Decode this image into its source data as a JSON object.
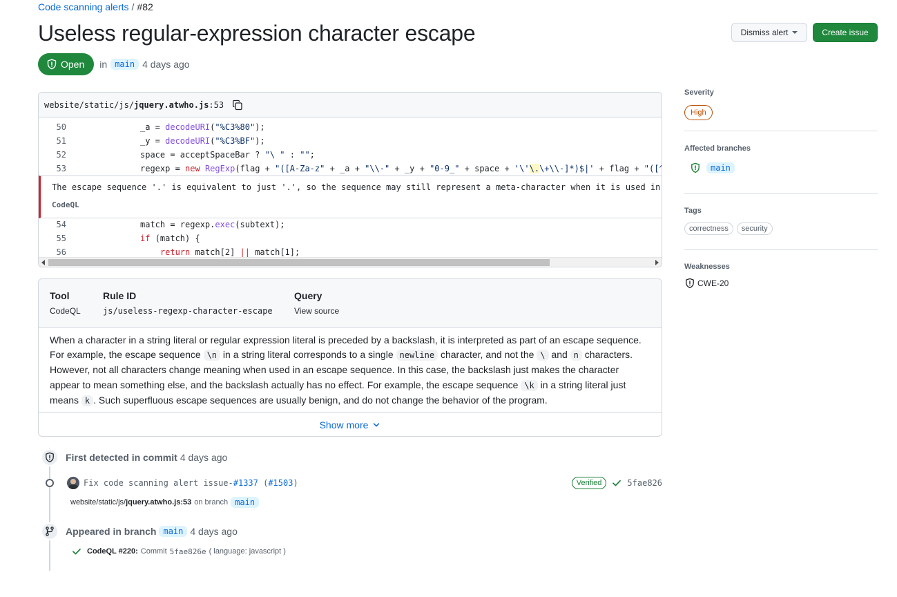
{
  "breadcrumb": {
    "parent": "Code scanning alerts",
    "separator": "/",
    "current": "#82"
  },
  "title": "Useless regular-expression character escape",
  "actions": {
    "dismiss_label": "Dismiss alert",
    "create_label": "Create issue"
  },
  "state": {
    "label": "Open",
    "in_text": "in",
    "branch": "main",
    "age": "4 days ago"
  },
  "code": {
    "path_prefix": "website/static/js/",
    "file": "jquery.atwho.js",
    "line_suffix": ":53",
    "line_numbers": [
      "50",
      "51",
      "52",
      "53",
      "54",
      "55",
      "56"
    ],
    "alert_message": "The escape sequence '.' is equivalent to just '.', so the sequence may still represent a meta-character when it is used in",
    "alert_tool": "CodeQL"
  },
  "rule": {
    "tool_header": "Tool",
    "tool_value": "CodeQL",
    "rule_header": "Rule ID",
    "rule_value": "js/useless-regexp-character-escape",
    "query_header": "Query",
    "query_value": "View source",
    "desc": {
      "p1": "When a character in a string literal or regular expression literal is preceded by a backslash, it is interpreted as part of an escape sequence.",
      "p2a": "For example, the escape sequence ",
      "c1": "\\n",
      "p2b": " in a string literal corresponds to a single ",
      "c2": "newline",
      "p2c": " character, and not the ",
      "c3": "\\",
      "p2d": " and ",
      "c4": "n",
      "p2e": " characters.",
      "p3": "However, not all characters change meaning when used in an escape sequence. In this case, the backslash just makes the character",
      "p4a": "appear to mean something else, and the backslash actually has no effect. For example, the escape sequence ",
      "c5": "\\k",
      "p4b": " in a string literal just",
      "p5a": "means ",
      "c6": "k",
      "p5b": ". Such superfluous escape sequences are usually benign, and do not change the behavior of the program."
    },
    "show_more": "Show more"
  },
  "timeline": {
    "first_detected": {
      "label": "First detected in commit",
      "age": "4 days ago"
    },
    "commit": {
      "message": "Fix code scanning alert issue-",
      "issue_link": "#1337",
      "pr_open": " (",
      "pr_link": "#1503",
      "pr_close": ")",
      "verified": "Verified",
      "sha": "5fae826",
      "path_prefix": "website/static/js/",
      "path_file": "jquery.atwho.js:53",
      "on_branch": "on branch",
      "branch": "main"
    },
    "appeared": {
      "label": "Appeared in branch",
      "branch": "main",
      "age": "4 days ago"
    },
    "analysis": {
      "name": "CodeQL #220:",
      "commit_text": "Commit",
      "sha": "5fae826e",
      "language": "( language: javascript )"
    }
  },
  "sidebar": {
    "severity_label": "Severity",
    "severity": "High",
    "branches_label": "Affected branches",
    "branch": "main",
    "tags_label": "Tags",
    "tags": [
      "correctness",
      "security"
    ],
    "weaknesses_label": "Weaknesses",
    "weakness": "CWE-20"
  },
  "colors": {
    "open_green": "#1f883d",
    "link_blue": "#0969da",
    "severity_orange": "#bc4c00",
    "alert_red": "#cf222e"
  }
}
